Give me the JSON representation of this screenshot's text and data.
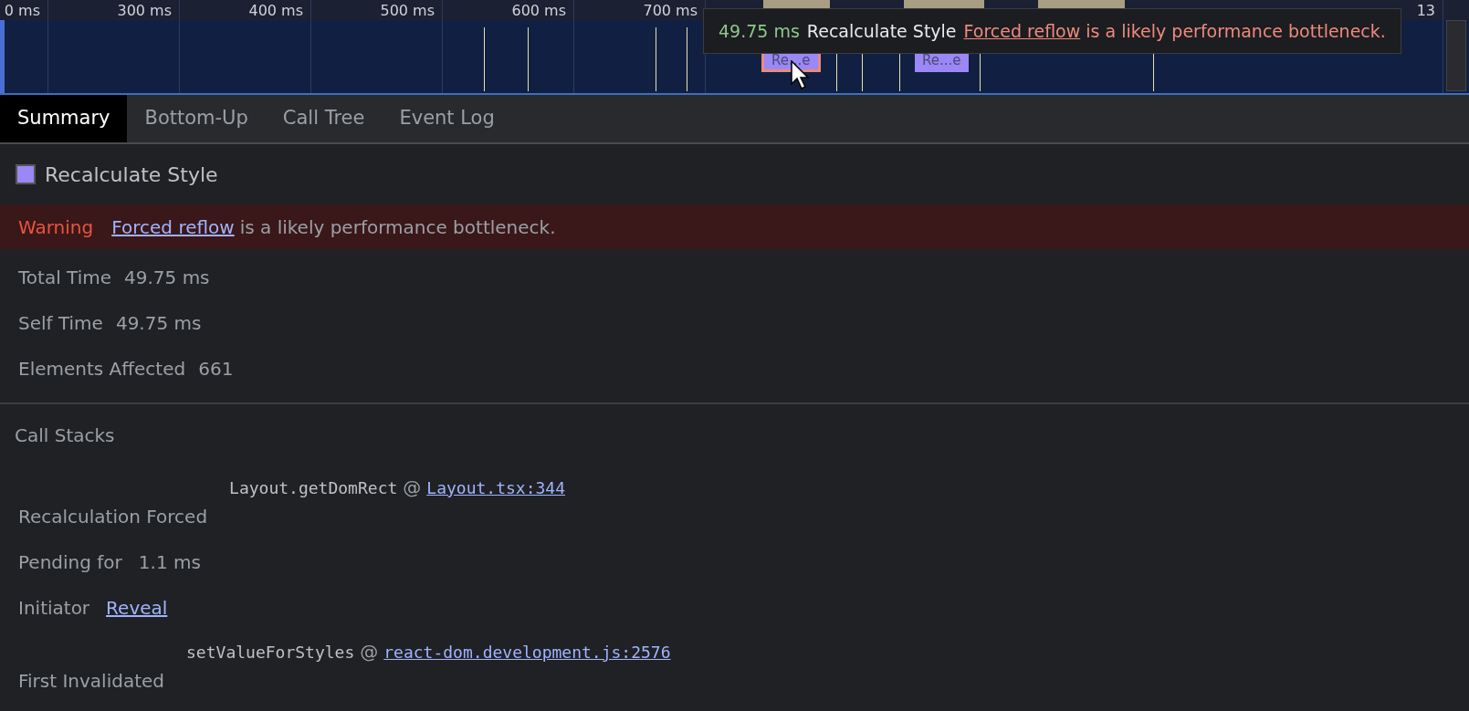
{
  "timeline": {
    "ticks": [
      "0 ms",
      "300 ms",
      "400 ms",
      "500 ms",
      "600 ms",
      "700 ms",
      "13"
    ],
    "events": [
      {
        "label": "Re...e",
        "selected": true
      },
      {
        "label": "Re...e",
        "selected": false
      }
    ],
    "tooltip": {
      "duration": "49.75 ms",
      "name": "Recalculate Style",
      "link": "Forced reflow",
      "message": "is a likely performance bottleneck."
    }
  },
  "tabs": [
    {
      "label": "Summary",
      "selected": true
    },
    {
      "label": "Bottom-Up",
      "selected": false
    },
    {
      "label": "Call Tree",
      "selected": false
    },
    {
      "label": "Event Log",
      "selected": false
    }
  ],
  "summary": {
    "title": "Recalculate Style",
    "color": "#9b87f5",
    "warning": {
      "label": "Warning",
      "link": "Forced reflow",
      "message": "is a likely performance bottleneck."
    },
    "details": [
      {
        "label": "Total Time",
        "value": "49.75 ms"
      },
      {
        "label": "Self Time",
        "value": "49.75 ms"
      },
      {
        "label": "Elements Affected",
        "value": "661"
      }
    ]
  },
  "call_stacks": {
    "title": "Call Stacks",
    "rows": [
      {
        "kind": "stack",
        "label": "Recalculation Forced",
        "function": "Layout.getDomRect",
        "at": "@",
        "link": "Layout.tsx:344"
      },
      {
        "kind": "value",
        "label": "Pending for",
        "value": "1.1 ms"
      },
      {
        "kind": "link",
        "label": "Initiator",
        "link": "Reveal"
      },
      {
        "kind": "stack",
        "label": "First Invalidated",
        "function": "setValueForStyles",
        "at": "@",
        "link": "react-dom.development.js:2576"
      }
    ]
  }
}
